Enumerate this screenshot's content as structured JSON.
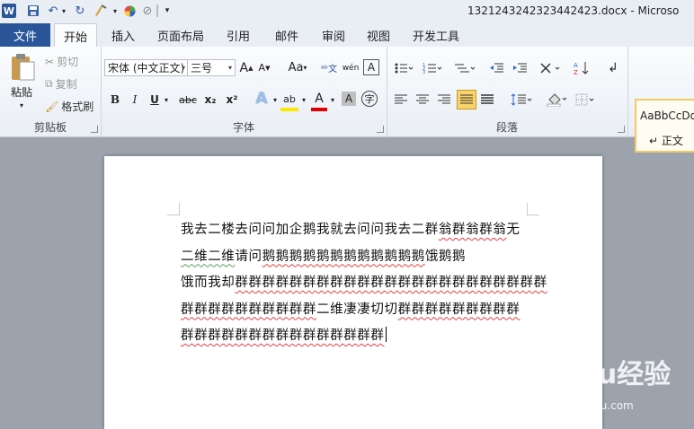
{
  "window": {
    "title": "1321243242323442423.docx - Microso",
    "app_icon": "word-icon"
  },
  "quick_access": {
    "icons": [
      "save-icon",
      "undo-icon",
      "redo-icon",
      "format-painter-icon",
      "color-icon",
      "no-edit-icon",
      "customize-icon"
    ]
  },
  "tabs": [
    {
      "label": "文件"
    },
    {
      "label": "开始"
    },
    {
      "label": "插入"
    },
    {
      "label": "页面布局"
    },
    {
      "label": "引用"
    },
    {
      "label": "邮件"
    },
    {
      "label": "审阅"
    },
    {
      "label": "视图"
    },
    {
      "label": "开发工具"
    }
  ],
  "clipboard": {
    "paste": "粘贴",
    "cut": "剪切",
    "copy": "复制",
    "format_painter": "格式刷",
    "group_label": "剪贴板"
  },
  "font": {
    "name": "宋体 (中文正文)",
    "size": "三号",
    "group_label": "字体",
    "bold": "B",
    "italic": "I",
    "underline": "U",
    "strike": "abc",
    "subscript": "x₂",
    "superscript": "x²",
    "case": "Aa",
    "grow": "A",
    "shrink": "A",
    "effects": "A",
    "highlight": "ab",
    "fontcolor": "A",
    "charshade": "A",
    "enclose": "字"
  },
  "paragraph": {
    "group_label": "段落"
  },
  "styles": {
    "preview": "AaBbCcDd",
    "name": "↵ 正文"
  },
  "document": {
    "lines": [
      [
        "我去二楼去问问加企鹅我就去问问我去二群",
        {
          "t": "翁群翁群翁",
          "w": "r"
        },
        "无"
      ],
      [
        {
          "t": "二维二维",
          "w": "g"
        },
        "请问",
        {
          "t": "鹅鹅鹅鹅鹅鹅鹅鹅鹅鹅鹅鹅",
          "w": "r"
        },
        "饿鹅鹅"
      ],
      [
        "饿而我却",
        {
          "t": "群群群群群群群群群群群群群群群群群群群群群群群",
          "w": "r"
        }
      ],
      [
        {
          "t": "群群群群群群群群群群",
          "w": "r"
        },
        "二维凄凄切切",
        {
          "t": "群群群群群群群群群",
          "w": "r"
        }
      ],
      [
        {
          "t": "群群群群群群群群群群群群群群群",
          "w": "r"
        },
        {
          "cursor": true
        }
      ]
    ]
  },
  "watermark": {
    "brand": "Baidu经验",
    "url": "jingyan.baidu.com"
  }
}
